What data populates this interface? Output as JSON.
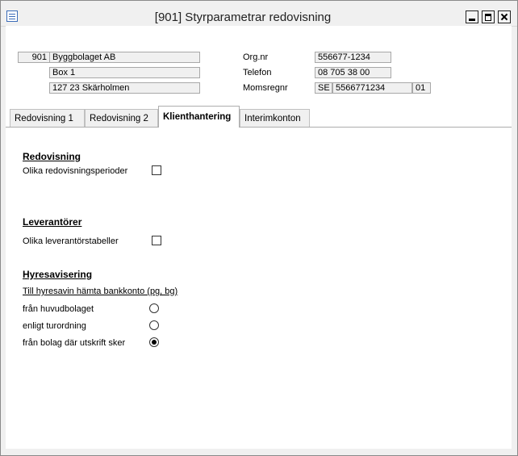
{
  "window": {
    "title": "[901]  Styrparametrar redovisning",
    "buttons": {
      "minimize": "minimize-icon",
      "maximize": "maximize-icon",
      "close": "close-icon"
    }
  },
  "company": {
    "number": "901",
    "name": "Byggbolaget AB",
    "address": "Box 1",
    "postal": "127 23  Skärholmen",
    "orgnr_label": "Org.nr",
    "orgnr": "556677-1234",
    "phone_label": "Telefon",
    "phone": "08 705 38 00",
    "vat_label": "Momsregnr",
    "vat_country": "SE",
    "vat_number": "5566771234",
    "vat_suffix": "01"
  },
  "tabs": [
    {
      "label": "Redovisning 1",
      "active": false
    },
    {
      "label": "Redovisning 2",
      "active": false
    },
    {
      "label": "Klienthantering",
      "active": true
    },
    {
      "label": "Interimkonton",
      "active": false
    }
  ],
  "redovisning": {
    "heading": "Redovisning",
    "option_label": "Olika redovisningsperioder",
    "checked": false
  },
  "leverantorer": {
    "heading": "Leverantörer",
    "option_label": "Olika leverantörstabeller",
    "checked": false
  },
  "hyresavisering": {
    "heading": "Hyresavisering",
    "subheading": "Till hyresavin hämta bankkonto (pg, bg)",
    "options": [
      {
        "label": "från huvudbolaget",
        "checked": false
      },
      {
        "label": "enligt turordning",
        "checked": false
      },
      {
        "label": "från bolag där utskrift sker",
        "checked": true
      }
    ]
  }
}
